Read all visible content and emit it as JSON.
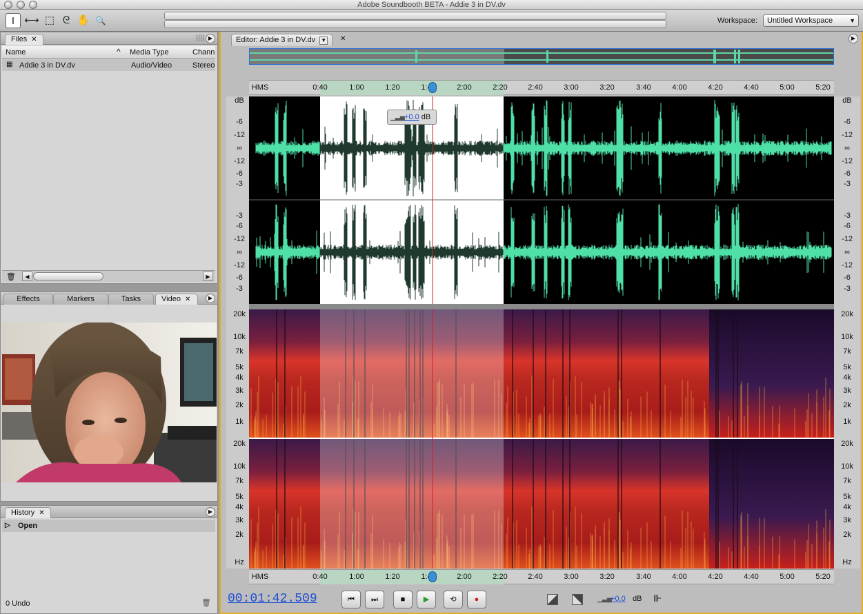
{
  "window": {
    "title": "Adobe Soundbooth BETA - Addie 3 in DV.dv"
  },
  "toolbar": {
    "tools": [
      {
        "icon": "time-selection-icon",
        "glyph": "I"
      },
      {
        "icon": "time-stretch-icon",
        "glyph": "⟷"
      },
      {
        "icon": "marquee-selection-icon",
        "glyph": "⬚"
      },
      {
        "icon": "lasso-icon",
        "glyph": "ᘓ"
      },
      {
        "icon": "hand-icon",
        "glyph": "✋"
      },
      {
        "icon": "zoom-icon",
        "glyph": "🔍"
      }
    ],
    "workspace_label": "Workspace:",
    "workspace_value": "Untitled Workspace"
  },
  "files_panel": {
    "tab": "Files",
    "columns": [
      "Name",
      "Media Type",
      "Chann"
    ],
    "rows": [
      {
        "name": "Addie 3 in DV.dv",
        "media_type": "Audio/Video",
        "channels": "Stereo"
      }
    ]
  },
  "mid_panel": {
    "tabs": [
      "Effects",
      "Markers",
      "Tasks",
      "Video"
    ]
  },
  "history_panel": {
    "tab": "History",
    "items": [
      "Open"
    ],
    "undo_count": "0 Undo"
  },
  "editor": {
    "tab": "Editor: Addie 3 in DV.dv",
    "ruler_labels": [
      "HMS",
      "0:40",
      "1:00",
      "1:20",
      "1:40",
      "2:00",
      "2:20",
      "2:40",
      "3:00",
      "3:20",
      "3:40",
      "4:00",
      "4:20",
      "4:40",
      "5:00",
      "5:20"
    ],
    "gain_hud": {
      "value": "+0.0",
      "unit": "dB"
    },
    "waveform_scale_left_top": [
      "dB",
      "-6",
      "-12",
      "∞",
      "-12",
      "-6",
      "-3"
    ],
    "waveform_scale_left_bottom": [
      "-3",
      "-6",
      "-12",
      "∞",
      "-12",
      "-6",
      "-3"
    ],
    "waveform_scale_right_top": [
      "dB",
      "-6",
      "-12",
      "∞",
      "-12",
      "-6",
      "-3"
    ],
    "waveform_scale_right_bottom": [
      "-3",
      "-6",
      "-12",
      "∞",
      "-12",
      "-6",
      "-3"
    ],
    "spectral_scale_top": [
      "20k",
      "10k",
      "7k",
      "5k",
      "4k",
      "3k",
      "2k",
      "1k"
    ],
    "spectral_scale_bottom": [
      "20k",
      "10k",
      "7k",
      "5k",
      "4k",
      "3k",
      "2k",
      "Hz"
    ],
    "colors": {
      "waveform": "#4fe0a8",
      "selection": "#ffffff",
      "playhead": "#cc2222",
      "accent": "#e0b020"
    }
  },
  "transport": {
    "timecode": "00:01:42.509",
    "gain": "+0.0",
    "gain_unit": "dB"
  }
}
